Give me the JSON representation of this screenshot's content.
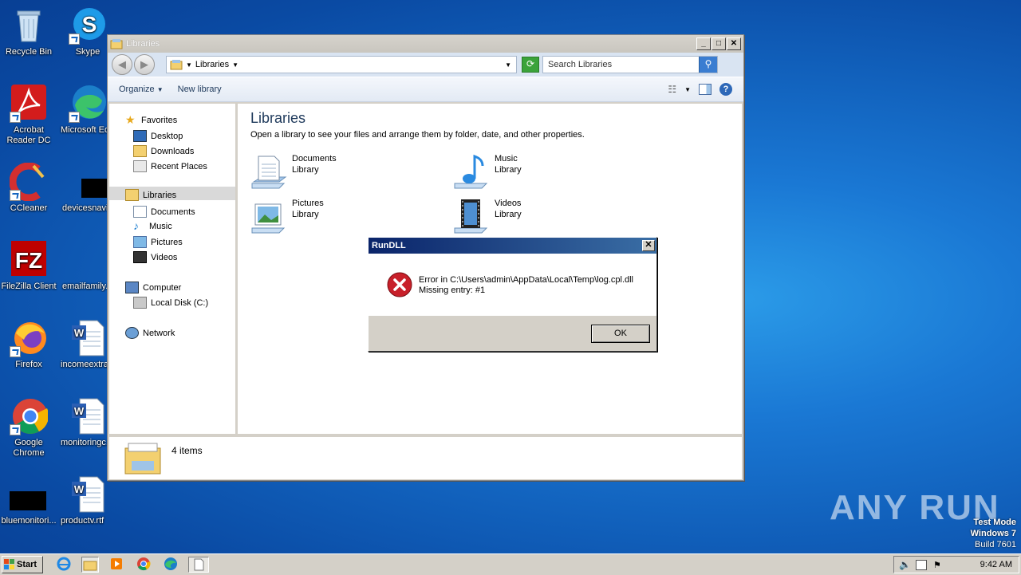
{
  "desktop": {
    "icons": [
      {
        "label": "Recycle Bin"
      },
      {
        "label": "Skype"
      },
      {
        "label": "Acrobat\nReader DC"
      },
      {
        "label": "Microsoft Edge"
      },
      {
        "label": "CCleaner"
      },
      {
        "label": "devicesnavi..."
      },
      {
        "label": "FileZilla Client"
      },
      {
        "label": "emailfamily..."
      },
      {
        "label": "Firefox"
      },
      {
        "label": "incomeextra..."
      },
      {
        "label": "Google\nChrome"
      },
      {
        "label": "monitoringc..."
      },
      {
        "label": "bluemonitori..."
      },
      {
        "label": "productv.rtf"
      }
    ]
  },
  "explorer": {
    "title": "Libraries",
    "address": "Libraries",
    "search_placeholder": "Search Libraries",
    "toolbar": {
      "organize": "Organize",
      "new_library": "New library"
    },
    "nav": {
      "favorites": "Favorites",
      "desktop": "Desktop",
      "downloads": "Downloads",
      "recent": "Recent Places",
      "libraries": "Libraries",
      "documents": "Documents",
      "music": "Music",
      "pictures": "Pictures",
      "videos": "Videos",
      "computer": "Computer",
      "local_disk": "Local Disk (C:)",
      "network": "Network"
    },
    "heading": "Libraries",
    "subheading": "Open a library to see your files and arrange them by folder, date, and other properties.",
    "libraries": [
      {
        "name": "Documents",
        "type": "Library"
      },
      {
        "name": "Music",
        "type": "Library"
      },
      {
        "name": "Pictures",
        "type": "Library"
      },
      {
        "name": "Videos",
        "type": "Library"
      }
    ],
    "status": "4 items"
  },
  "dialog": {
    "title": "RunDLL",
    "line1": "Error in C:\\Users\\admin\\AppData\\Local\\Temp\\log.cpl.dll",
    "line2": "Missing entry: #1",
    "ok": "OK"
  },
  "taskbar": {
    "start": "Start",
    "time": "9:42 AM"
  },
  "watermark": {
    "line1": "Test Mode",
    "line2": "Windows 7",
    "line3": "Build 7601",
    "brand": "ANY RUN"
  }
}
